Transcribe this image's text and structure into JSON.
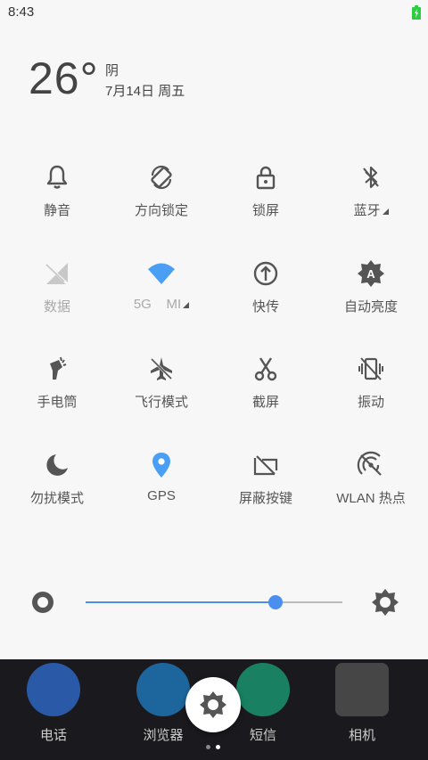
{
  "status_bar": {
    "time": "8:43",
    "battery_color": "#2ecc40"
  },
  "weather": {
    "temperature": "26°",
    "condition": "阴",
    "date": "7月14日 周五"
  },
  "quick_settings": {
    "row1": [
      {
        "label": "静音",
        "icon": "bell-icon"
      },
      {
        "label": "方向锁定",
        "icon": "rotation-lock-icon"
      },
      {
        "label": "锁屏",
        "icon": "lock-icon"
      },
      {
        "label": "蓝牙",
        "icon": "bluetooth-icon"
      }
    ],
    "row2": [
      {
        "label": "数据",
        "icon": "mobile-data-off-icon"
      },
      {
        "label": "5G    MI",
        "icon": "wifi-icon"
      },
      {
        "label": "快传",
        "icon": "quick-transfer-icon"
      },
      {
        "label": "自动亮度",
        "icon": "auto-brightness-icon"
      }
    ],
    "row3": [
      {
        "label": "手电筒",
        "icon": "flashlight-icon"
      },
      {
        "label": "飞行模式",
        "icon": "airplane-icon"
      },
      {
        "label": "截屏",
        "icon": "scissors-icon"
      },
      {
        "label": "振动",
        "icon": "vibrate-off-icon"
      }
    ],
    "row4": [
      {
        "label": "勿扰模式",
        "icon": "moon-icon"
      },
      {
        "label": "GPS",
        "icon": "location-icon"
      },
      {
        "label": "屏蔽按键",
        "icon": "block-keys-icon"
      },
      {
        "label": "WLAN 热点",
        "icon": "hotspot-off-icon"
      }
    ],
    "accent_color": "#4a9ff5"
  },
  "brightness": {
    "level": 0.74,
    "color": "#4a8ef0"
  },
  "dock": {
    "apps": [
      {
        "label": "电话",
        "icon": "phone-icon"
      },
      {
        "label": "浏览器",
        "icon": "browser-icon"
      },
      {
        "label": "短信",
        "icon": "messages-icon"
      },
      {
        "label": "相机",
        "icon": "camera-icon"
      }
    ],
    "settings_icon": "settings-gear-icon",
    "page_indicator": {
      "count": 2,
      "active": 1
    }
  }
}
